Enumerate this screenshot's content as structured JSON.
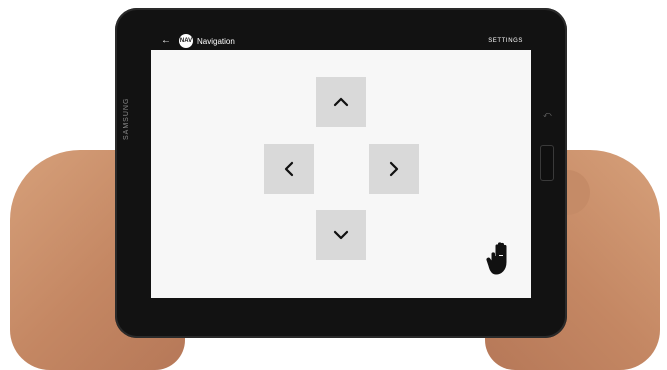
{
  "app": {
    "title": "Navigation",
    "settings_label": "SETTINGS",
    "logo_text": "NAV"
  },
  "device": {
    "brand": "SAMSUNG"
  },
  "controls": {
    "up": {
      "icon": "chevron-up-icon"
    },
    "left": {
      "icon": "chevron-left-icon"
    },
    "right": {
      "icon": "chevron-right-icon"
    },
    "down": {
      "icon": "chevron-down-icon"
    },
    "stop": {
      "icon": "hand-icon"
    }
  },
  "colors": {
    "screen_bg": "#f7f7f7",
    "pad_bg": "#d9d9d9",
    "appbar_bg": "#121212",
    "icon": "#111111"
  }
}
